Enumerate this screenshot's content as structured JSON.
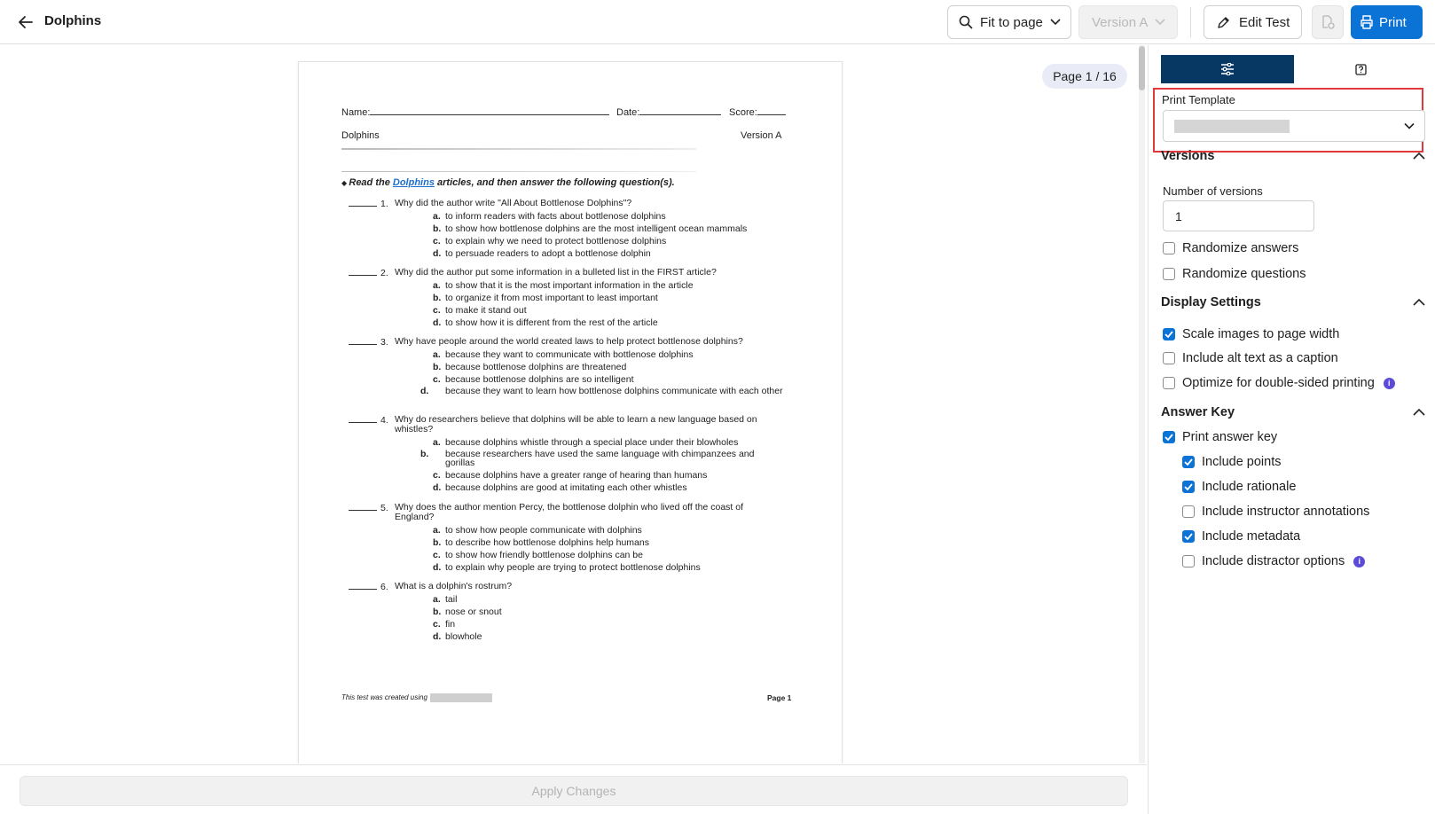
{
  "header": {
    "title": "Dolphins",
    "fit_label": "Fit to page",
    "version_label": "Version A",
    "edit_label": "Edit Test",
    "print_label": "Print"
  },
  "preview": {
    "page_indicator": "Page 1 / 16",
    "name_label": "Name:",
    "date_label": "Date:",
    "score_label": "Score:",
    "test_title": "Dolphins",
    "version": "Version A",
    "instruction_prefix": "Read the ",
    "instruction_link": "Dolphins",
    "instruction_suffix": " articles, and then answer the following question(s).",
    "questions": [
      {
        "num": "1.",
        "stem": "Why did the author write \"All About Bottlenose Dolphins\"?",
        "options": [
          {
            "letter": "a.",
            "text": "to inform readers with facts about bottlenose dolphins"
          },
          {
            "letter": "b.",
            "text": "to show how bottlenose dolphins are the most intelligent ocean mammals"
          },
          {
            "letter": "c.",
            "text": "to explain why we need to protect bottlenose dolphins"
          },
          {
            "letter": "d.",
            "text": "to persuade readers to adopt a bottlenose dolphin"
          }
        ]
      },
      {
        "num": "2.",
        "stem": "Why did the author put some information in a bulleted list in the FIRST article?",
        "options": [
          {
            "letter": "a.",
            "text": "to show that it is the most important information in the article"
          },
          {
            "letter": "b.",
            "text": "to organize it from most important to least important"
          },
          {
            "letter": "c.",
            "text": "to make it stand out"
          },
          {
            "letter": "d.",
            "text": "to show how it is different from the rest of the article"
          }
        ]
      },
      {
        "num": "3.",
        "stem": "Why have people around the world created laws to help protect bottlenose dolphins?",
        "options": [
          {
            "letter": "a.",
            "text": "because they want to communicate with bottlenose dolphins"
          },
          {
            "letter": "b.",
            "text": "because bottlenose dolphins are threatened"
          },
          {
            "letter": "c.",
            "text": "because bottlenose dolphins are so intelligent"
          },
          {
            "letter": "d.",
            "text": "because they want to learn how bottlenose dolphins communicate with each other"
          }
        ]
      },
      {
        "num": "4.",
        "stem": "Why do researchers believe that dolphins will be able to learn a new language based on whistles?",
        "options": [
          {
            "letter": "a.",
            "text": "because dolphins whistle through a special place under their blowholes"
          },
          {
            "letter": "b.",
            "text": "because researchers have used the same language with chimpanzees and gorillas"
          },
          {
            "letter": "c.",
            "text": "because dolphins have a greater range of hearing than humans"
          },
          {
            "letter": "d.",
            "text": "because dolphins are good at imitating each other whistles"
          }
        ]
      },
      {
        "num": "5.",
        "stem": "Why does the author mention Percy, the bottlenose dolphin who lived off the coast of England?",
        "options": [
          {
            "letter": "a.",
            "text": "to show how people communicate with dolphins"
          },
          {
            "letter": "b.",
            "text": "to describe how bottlenose dolphins help humans"
          },
          {
            "letter": "c.",
            "text": "to show how friendly bottlenose dolphins can be"
          },
          {
            "letter": "d.",
            "text": "to explain why people are trying to protect bottlenose dolphins"
          }
        ]
      },
      {
        "num": "6.",
        "stem": "What is a dolphin's rostrum?",
        "options": [
          {
            "letter": "a.",
            "text": "tail"
          },
          {
            "letter": "b.",
            "text": "nose or snout"
          },
          {
            "letter": "c.",
            "text": "fin"
          },
          {
            "letter": "d.",
            "text": "blowhole"
          }
        ]
      }
    ],
    "footer_left": "This test was created using",
    "footer_right": "Page 1"
  },
  "apply_label": "Apply Changes",
  "sidebar": {
    "print_template_label": "Print Template",
    "versions_heading": "Versions",
    "num_versions_label": "Number of versions",
    "num_versions_value": "1",
    "randomize_answers": "Randomize answers",
    "randomize_questions": "Randomize questions",
    "display_heading": "Display Settings",
    "scale_images": "Scale images to page width",
    "alt_text": "Include alt text as a caption",
    "double_sided": "Optimize for double-sided printing",
    "answer_key_heading": "Answer Key",
    "print_answer_key": "Print answer key",
    "include_points": "Include points",
    "include_rationale": "Include rationale",
    "include_instructor": "Include instructor annotations",
    "include_metadata": "Include metadata",
    "include_distractor": "Include distractor options"
  },
  "colors": {
    "primary": "#0b72d6",
    "tab_active": "#073763",
    "highlight": "#e0393b",
    "info": "#5b4bd6"
  }
}
